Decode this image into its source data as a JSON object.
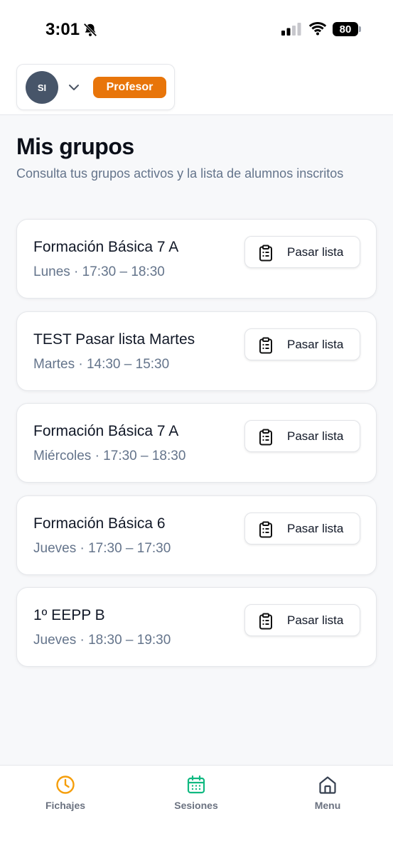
{
  "status_bar": {
    "time": "3:01",
    "battery": "80",
    "icons": [
      "bell-slash-icon",
      "signal-icon",
      "wifi-icon",
      "battery-icon"
    ]
  },
  "header": {
    "avatar_initials": "SI",
    "role_badge": "Profesor",
    "colors": {
      "badge": "#e8750a",
      "avatar": "#475569"
    }
  },
  "main": {
    "title": "Mis grupos",
    "subtitle": "Consulta tus grupos activos y la lista de alumnos inscritos",
    "action_label": "Pasar lista",
    "groups": [
      {
        "name": "Formación Básica 7 A",
        "schedule": "Lunes · 17:30 – 18:30"
      },
      {
        "name": "TEST Pasar lista Martes",
        "schedule": "Martes · 14:30 – 15:30"
      },
      {
        "name": "Formación Básica 7 A",
        "schedule": "Miércoles · 17:30 – 18:30"
      },
      {
        "name": "Formación Básica 6",
        "schedule": "Jueves · 17:30 – 17:30"
      },
      {
        "name": "1º EEPP B",
        "schedule": "Jueves · 18:30 – 19:30"
      }
    ]
  },
  "bottom_nav": {
    "items": [
      {
        "label": "Fichajes",
        "icon": "clock-icon",
        "color": "#f59e0b"
      },
      {
        "label": "Sesiones",
        "icon": "calendar-icon",
        "color": "#10b981"
      },
      {
        "label": "Menu",
        "icon": "home-icon",
        "color": "#374151"
      }
    ]
  }
}
